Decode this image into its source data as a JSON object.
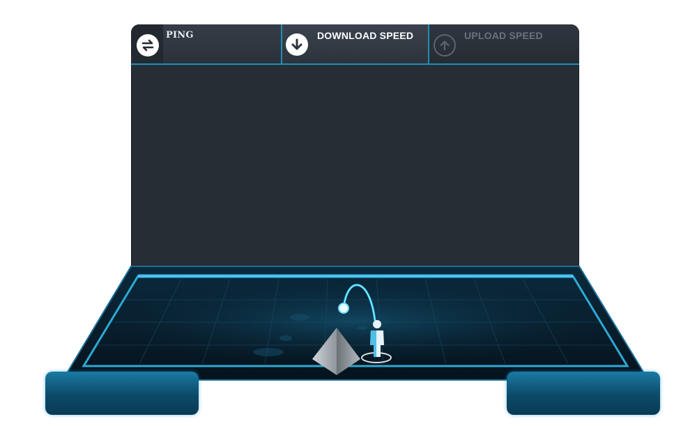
{
  "tabs": {
    "ping": {
      "label": "PING",
      "icon": "ping-exchange-icon"
    },
    "download": {
      "label": "DOWNLOAD SPEED",
      "icon": "download-arrow-icon",
      "active": true
    },
    "upload": {
      "label": "UPLOAD SPEED",
      "icon": "upload-arrow-icon",
      "active": false
    }
  },
  "scene": {
    "server_icon": "pyramid-server-icon",
    "user_icon": "user-figure-icon",
    "accent_color": "#1f8fb8",
    "glow_color": "#3ad4ff"
  }
}
